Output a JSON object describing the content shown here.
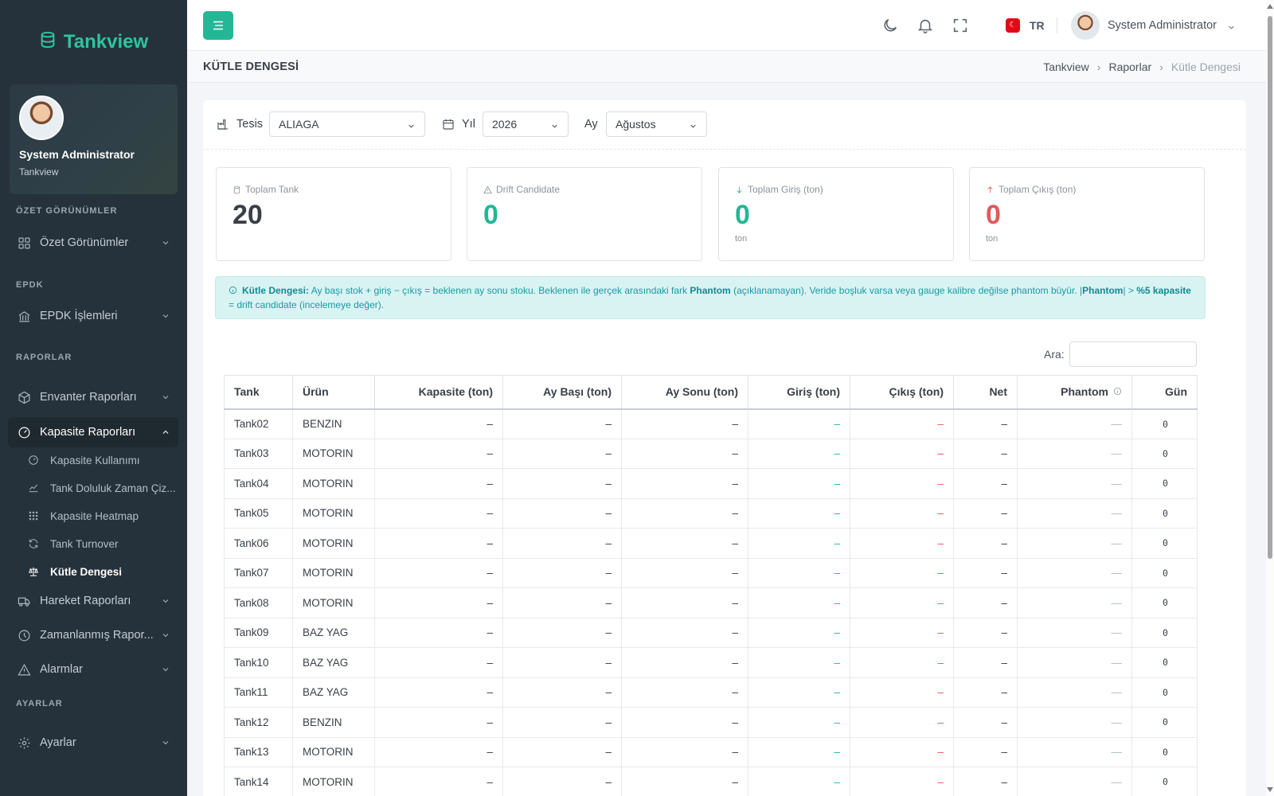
{
  "app": {
    "brand": "Tankview",
    "accent": "#24b796"
  },
  "sidebar": {
    "user_name": "System Administrator",
    "user_org": "Tankview",
    "sections": {
      "ozet": "ÖZET GÖRÜNÜMLER",
      "epdk": "EPDK",
      "raporlar": "RAPORLAR",
      "ayarlar": "AYARLAR"
    },
    "items": {
      "ozet": "Özet Görünümler",
      "epdk": "EPDK İşlemleri",
      "envanter": "Envanter Raporları",
      "kapasite": "Kapasite Raporları",
      "hareket": "Hareket Raporları",
      "zamanlanmis": "Zamanlanmış Rapor...",
      "alarmlar": "Alarmlar",
      "ayarlar": "Ayarlar"
    },
    "sub_items": {
      "kullanim": "Kapasite Kullanımı",
      "doluluk": "Tank Doluluk Zaman Çiz...",
      "heatmap": "Kapasite Heatmap",
      "turnover": "Tank Turnover",
      "kutle": "Kütle Dengesi"
    }
  },
  "topbar": {
    "language": "TR",
    "user_name": "System Administrator"
  },
  "page": {
    "title": "KÜTLE DENGESİ",
    "breadcrumb": [
      "Tankview",
      "Raporlar",
      "Kütle Dengesi"
    ]
  },
  "filters": {
    "tesis_label": "Tesis",
    "tesis_value": "ALIAGA",
    "yil_label": "Yıl",
    "yil_value": "2026",
    "ay_label": "Ay",
    "ay_value": "Ağustos"
  },
  "stats": {
    "toplam_tank": {
      "label": "Toplam Tank",
      "value": "20"
    },
    "drift": {
      "label": "Drift Candidate",
      "value": "0"
    },
    "giris": {
      "label": "Toplam Giriş (ton)",
      "value": "0",
      "unit": "ton"
    },
    "cikis": {
      "label": "Toplam Çıkış (ton)",
      "value": "0",
      "unit": "ton"
    }
  },
  "info": {
    "strong1": "Kütle Dengesi:",
    "text1": " Ay başı stok + giriş − çıkış = beklenen ay sonu stoku. Beklenen ile gerçek arasındaki fark ",
    "strong2": "Phantom",
    "text2": " (açıklanamayan). Veride boşluk varsa veya gauge kalibre değilse phantom büyür. |",
    "strong3": "Phantom",
    "text3": "| > ",
    "strong4": "%5 kapasite",
    "text4": " = drift candidate (incelemeye değer)."
  },
  "search": {
    "label": "Ara:"
  },
  "table": {
    "headers": [
      "Tank",
      "Ürün",
      "Kapasite (ton)",
      "Ay Başı (ton)",
      "Ay Sonu (ton)",
      "Giriş (ton)",
      "Çıkış (ton)",
      "Net",
      "Phantom",
      "Gün"
    ],
    "rows": [
      [
        "Tank02",
        "BENZIN",
        "–",
        "–",
        "–",
        "–",
        "–",
        "–",
        "—",
        "0"
      ],
      [
        "Tank03",
        "MOTORIN",
        "–",
        "–",
        "–",
        "–",
        "–",
        "–",
        "—",
        "0"
      ],
      [
        "Tank04",
        "MOTORIN",
        "–",
        "–",
        "–",
        "–",
        "–",
        "–",
        "—",
        "0"
      ],
      [
        "Tank05",
        "MOTORIN",
        "–",
        "–",
        "–",
        "–",
        "–",
        "–",
        "—",
        "0"
      ],
      [
        "Tank06",
        "MOTORIN",
        "–",
        "–",
        "–",
        "–",
        "–",
        "–",
        "—",
        "0"
      ],
      [
        "Tank07",
        "MOTORIN",
        "–",
        "–",
        "–",
        "–",
        "–",
        "–",
        "—",
        "0"
      ],
      [
        "Tank08",
        "MOTORIN",
        "–",
        "–",
        "–",
        "–",
        "–",
        "–",
        "—",
        "0"
      ],
      [
        "Tank09",
        "BAZ YAG",
        "–",
        "–",
        "–",
        "–",
        "–",
        "–",
        "—",
        "0"
      ],
      [
        "Tank10",
        "BAZ YAG",
        "–",
        "–",
        "–",
        "–",
        "–",
        "–",
        "—",
        "0"
      ],
      [
        "Tank11",
        "BAZ YAG",
        "–",
        "–",
        "–",
        "–",
        "–",
        "–",
        "—",
        "0"
      ],
      [
        "Tank12",
        "BENZIN",
        "–",
        "–",
        "–",
        "–",
        "–",
        "–",
        "—",
        "0"
      ],
      [
        "Tank13",
        "MOTORIN",
        "–",
        "–",
        "–",
        "–",
        "–",
        "–",
        "—",
        "0"
      ],
      [
        "Tank14",
        "MOTORIN",
        "–",
        "–",
        "–",
        "–",
        "–",
        "–",
        "—",
        "0"
      ]
    ]
  }
}
